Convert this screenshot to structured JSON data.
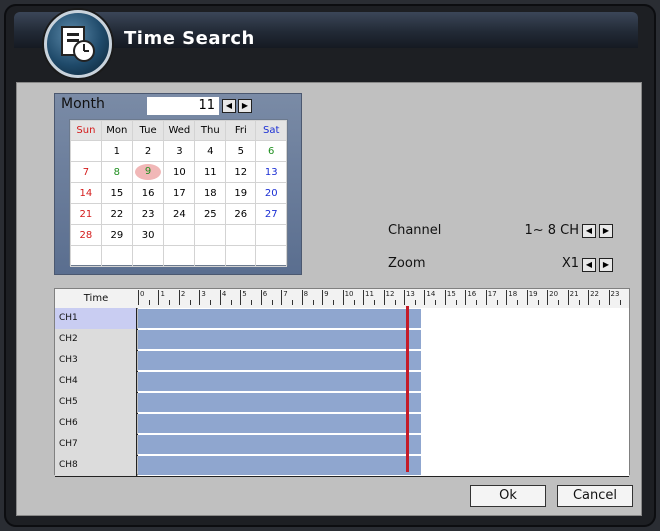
{
  "window": {
    "title": "Time Search"
  },
  "calendar": {
    "month_label": "Month",
    "month_value": "11",
    "weekdays": [
      "Sun",
      "Mon",
      "Tue",
      "Wed",
      "Thu",
      "Fri",
      "Sat"
    ],
    "weeks": [
      [
        "",
        "1",
        "2",
        "3",
        "4",
        "5",
        "6"
      ],
      [
        "7",
        "8",
        "9",
        "10",
        "11",
        "12",
        "13"
      ],
      [
        "14",
        "15",
        "16",
        "17",
        "18",
        "19",
        "20"
      ],
      [
        "21",
        "22",
        "23",
        "24",
        "25",
        "26",
        "27"
      ],
      [
        "28",
        "29",
        "30",
        "",
        "",
        "",
        ""
      ],
      [
        "",
        "",
        "",
        "",
        "",
        "",
        ""
      ]
    ],
    "selected_day": "9",
    "green_days": [
      "6",
      "7",
      "8",
      "9"
    ]
  },
  "channel": {
    "label": "Channel",
    "value": "1~ 8 CH"
  },
  "zoom": {
    "label": "Zoom",
    "value": "X1"
  },
  "timeline": {
    "time_label": "Time",
    "hours": [
      "0",
      "1",
      "2",
      "3",
      "4",
      "5",
      "6",
      "7",
      "8",
      "9",
      "10",
      "11",
      "12",
      "13",
      "14",
      "15",
      "16",
      "17",
      "18",
      "19",
      "20",
      "21",
      "22",
      "23"
    ],
    "channels": [
      "CH1",
      "CH2",
      "CH3",
      "CH4",
      "CH5",
      "CH6",
      "CH7",
      "CH8"
    ],
    "recorded_until_hour": 13.85,
    "cursor_hour": 13.1
  },
  "buttons": {
    "ok": "Ok",
    "cancel": "Cancel"
  },
  "icons": {
    "logo": "time-search-icon",
    "prev": "arrow-left-icon",
    "next": "arrow-right-icon"
  },
  "colors": {
    "record_fill": "#8fa6cf",
    "cursor": "#c41b29",
    "selected_day": "#f1b7b7"
  }
}
